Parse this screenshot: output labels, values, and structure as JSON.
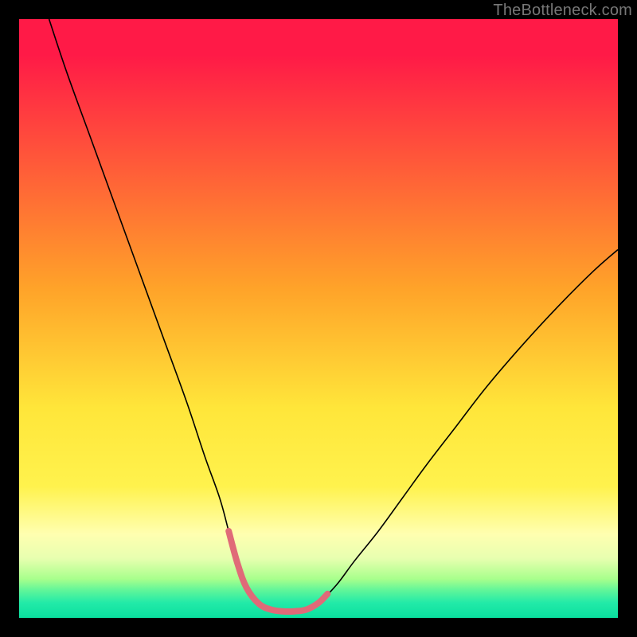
{
  "watermark": "TheBottleneck.com",
  "chart_data": {
    "type": "line",
    "title": "",
    "xlabel": "",
    "ylabel": "",
    "xlim": [
      0,
      100
    ],
    "ylim": [
      0,
      100
    ],
    "grid": false,
    "legend": false,
    "gradient_stops": [
      {
        "offset": 0.0,
        "color": "#ff1a47"
      },
      {
        "offset": 0.06,
        "color": "#ff1a47"
      },
      {
        "offset": 0.45,
        "color": "#ffa329"
      },
      {
        "offset": 0.65,
        "color": "#ffe63a"
      },
      {
        "offset": 0.78,
        "color": "#fff24d"
      },
      {
        "offset": 0.86,
        "color": "#ffffb0"
      },
      {
        "offset": 0.9,
        "color": "#e8ffb0"
      },
      {
        "offset": 0.935,
        "color": "#a8ff8c"
      },
      {
        "offset": 0.955,
        "color": "#5cf59a"
      },
      {
        "offset": 0.975,
        "color": "#22eaa8"
      },
      {
        "offset": 1.0,
        "color": "#0adf9e"
      }
    ],
    "series": [
      {
        "name": "bottleneck-curve",
        "stroke": "#000000",
        "stroke_width": 1.6,
        "x": [
          5,
          8,
          12,
          16,
          20,
          24,
          28,
          31,
          33.5,
          35,
          36.5,
          38,
          40,
          42,
          44,
          46,
          48,
          50,
          53,
          56,
          60,
          64,
          68,
          73,
          78,
          84,
          90,
          96,
          100
        ],
        "y": [
          100,
          91,
          80,
          69,
          58,
          47,
          36,
          27,
          20,
          14.5,
          9,
          5,
          2.4,
          1.4,
          1.1,
          1.1,
          1.4,
          2.5,
          5.5,
          9.5,
          14.5,
          20,
          25.5,
          32,
          38.5,
          45.5,
          52,
          58,
          61.5
        ]
      },
      {
        "name": "bottom-highlight",
        "stroke": "#e06a78",
        "stroke_width": 8,
        "linecap": "round",
        "x": [
          35,
          36.5,
          38,
          40,
          42,
          44,
          46,
          48,
          50,
          51.5
        ],
        "y": [
          14.5,
          9,
          5,
          2.4,
          1.4,
          1.1,
          1.1,
          1.4,
          2.5,
          4.0
        ]
      }
    ]
  }
}
